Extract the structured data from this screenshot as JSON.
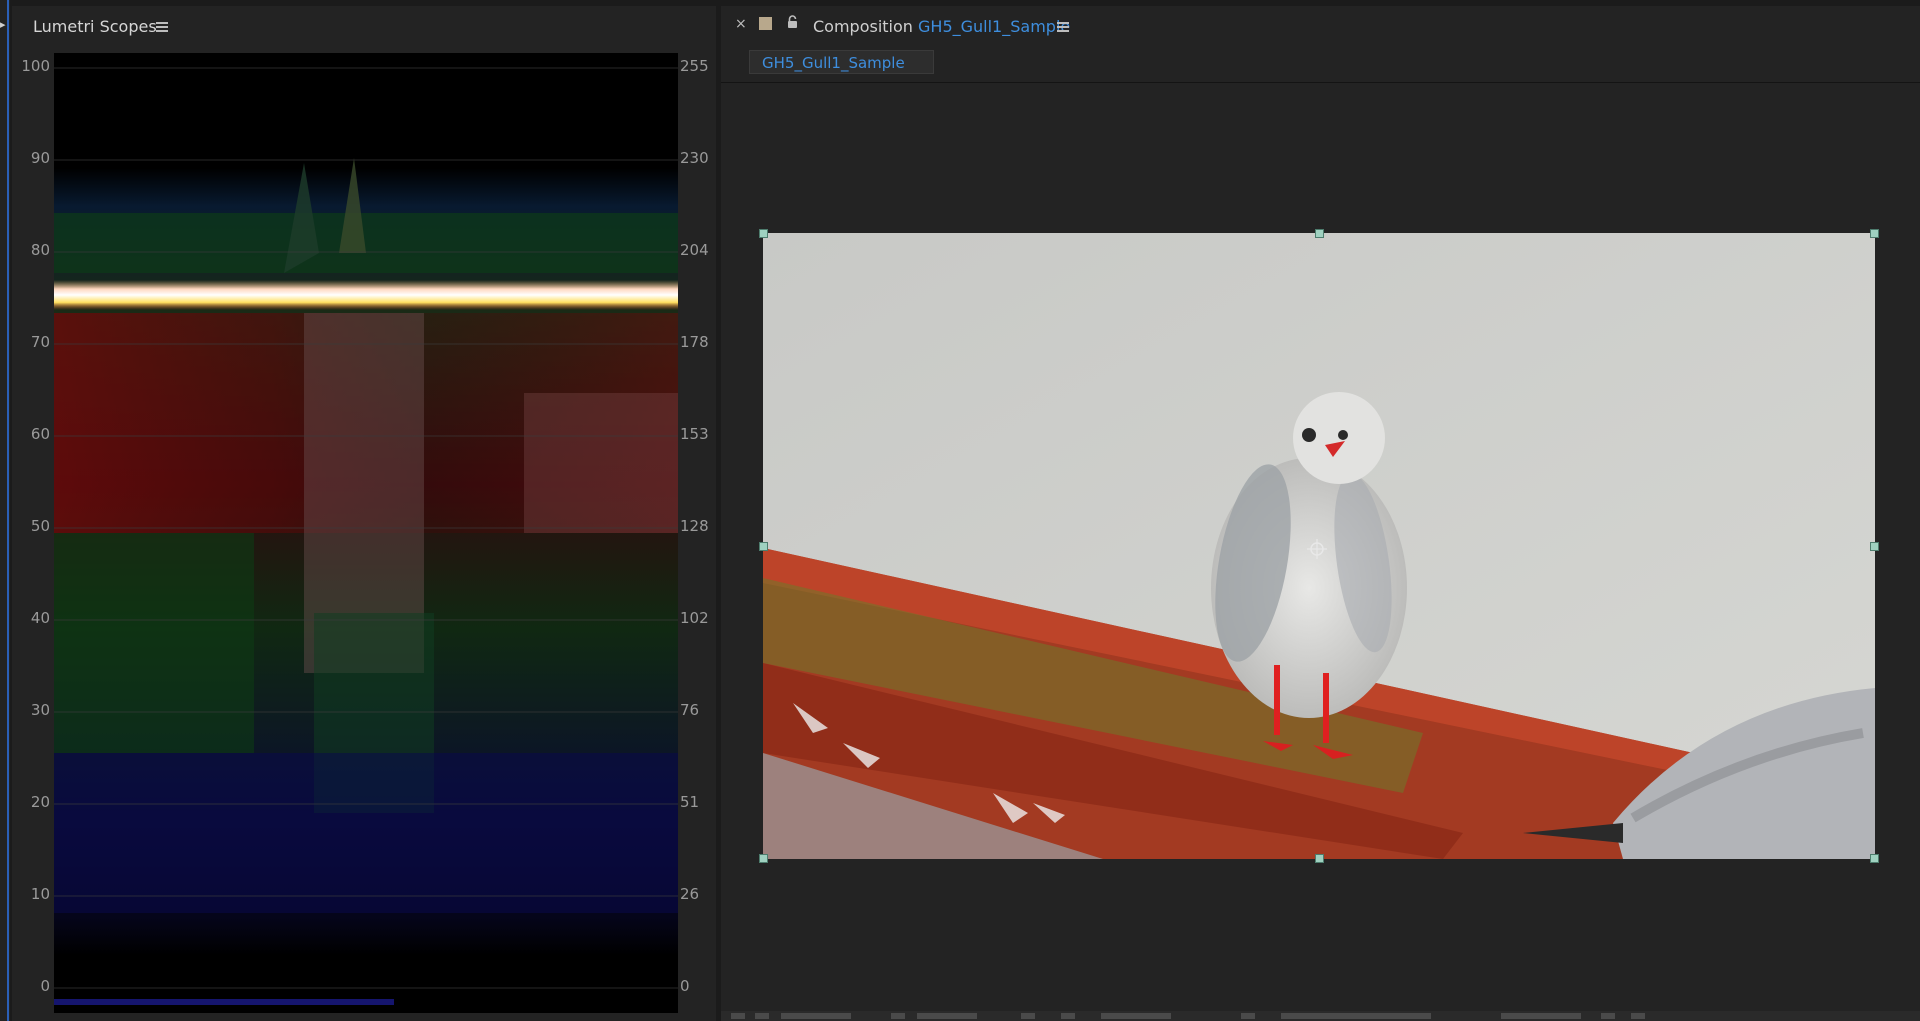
{
  "scopes_panel": {
    "title": "Lumetri Scopes",
    "menu_icon": "hamburger-menu-icon",
    "scale_left": [
      "100",
      "90",
      "80",
      "70",
      "60",
      "50",
      "40",
      "30",
      "20",
      "10",
      "0"
    ],
    "scale_right": [
      "255",
      "230",
      "204",
      "178",
      "153",
      "128",
      "102",
      "76",
      "51",
      "26",
      "0"
    ]
  },
  "composition_panel": {
    "close_icon": "close-icon",
    "label_swatch_color": "#b8a88c",
    "lock_icon": "lock-icon",
    "title_prefix": "Composition",
    "title_name": "GH5_Gull1_Sample",
    "menu_icon": "hamburger-menu-icon",
    "tab_label": "GH5_Gull1_Sample",
    "accent_color": "#3e8ede"
  },
  "viewer": {
    "content": "seagull-on-red-roof-footage",
    "selection_handles": "transform-handle-icon",
    "anchor_point": "anchor-point-icon"
  }
}
